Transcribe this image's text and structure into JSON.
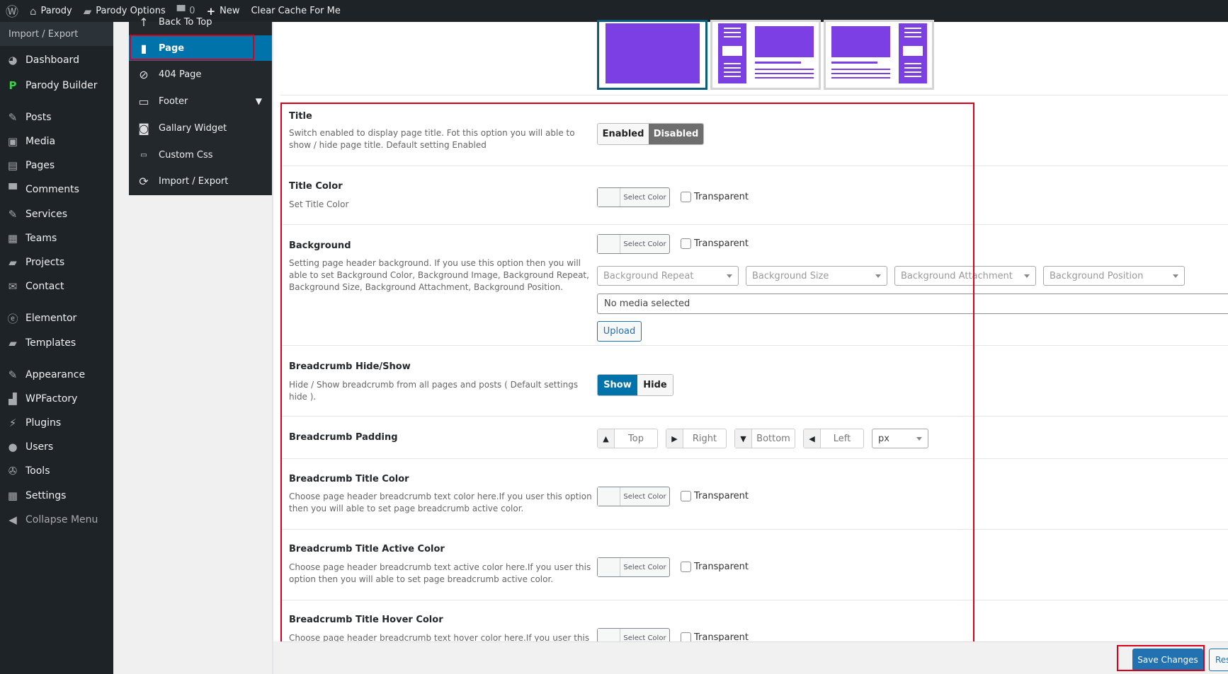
{
  "admin_bar": {
    "site_name": "Parody",
    "options_label": "Parody Options",
    "comments_count": "0",
    "new_label": "New",
    "clear_cache_label": "Clear Cache For Me"
  },
  "admin_menu": {
    "header": "Import / Export",
    "items": [
      {
        "label": "Dashboard",
        "icon": "dashboard-icon"
      },
      {
        "label": "Parody Builder",
        "icon": "parody-builder-icon"
      },
      {
        "label": "Posts",
        "icon": "pin-icon"
      },
      {
        "label": "Media",
        "icon": "media-icon"
      },
      {
        "label": "Pages",
        "icon": "pages-icon"
      },
      {
        "label": "Comments",
        "icon": "comment-icon"
      },
      {
        "label": "Services",
        "icon": "services-icon"
      },
      {
        "label": "Teams",
        "icon": "teams-icon"
      },
      {
        "label": "Projects",
        "icon": "folder-icon"
      },
      {
        "label": "Contact",
        "icon": "mail-icon"
      },
      {
        "label": "Elementor",
        "icon": "elementor-icon"
      },
      {
        "label": "Templates",
        "icon": "folder-icon"
      },
      {
        "label": "Appearance",
        "icon": "brush-icon"
      },
      {
        "label": "WPFactory",
        "icon": "chart-icon"
      },
      {
        "label": "Plugins",
        "icon": "plug-icon"
      },
      {
        "label": "Users",
        "icon": "user-icon"
      },
      {
        "label": "Tools",
        "icon": "wrench-icon"
      },
      {
        "label": "Settings",
        "icon": "settings-icon"
      },
      {
        "label": "Collapse Menu",
        "icon": "collapse-icon"
      }
    ]
  },
  "options_nav": {
    "items": [
      {
        "label": "Back To Top",
        "icon": "arrow-up-icon"
      },
      {
        "label": "Page",
        "icon": "page-icon",
        "active": true
      },
      {
        "label": "404 Page",
        "icon": "forbidden-icon"
      },
      {
        "label": "Footer",
        "icon": "monitor-icon",
        "has_submenu": true
      },
      {
        "label": "Gallary Widget",
        "icon": "camera-icon"
      },
      {
        "label": "Custom Css",
        "icon": "css-icon"
      },
      {
        "label": "Import / Export",
        "icon": "refresh-icon"
      }
    ]
  },
  "fields": {
    "title": {
      "label": "Title",
      "description": "Switch enabled to display page title. Fot this option you will able to show / hide page title. Default setting Enabled",
      "enabled_label": "Enabled",
      "disabled_label": "Disabled",
      "selected": "Disabled"
    },
    "title_color": {
      "label": "Title Color",
      "description": "Set Title Color",
      "picker_label": "Select Color",
      "transparent_label": "Transparent"
    },
    "background": {
      "label": "Background",
      "description": "Setting page header background. If you use this option then you will able to set Background Color, Background Image, Background Repeat, Background Size, Background Attachment, Background Position.",
      "picker_label": "Select Color",
      "transparent_label": "Transparent",
      "repeat_placeholder": "Background Repeat",
      "size_placeholder": "Background Size",
      "attachment_placeholder": "Background Attachment",
      "position_placeholder": "Background Position",
      "media_text": "No media selected",
      "upload_label": "Upload"
    },
    "breadcrumb_toggle": {
      "label": "Breadcrumb Hide/Show",
      "description": "Hide / Show breadcrumb from all pages and posts ( Default settings hide ).",
      "show_label": "Show",
      "hide_label": "Hide",
      "selected": "Show"
    },
    "breadcrumb_padding": {
      "label": "Breadcrumb Padding",
      "top": "Top",
      "right": "Right",
      "bottom": "Bottom",
      "left": "Left",
      "unit": "px"
    },
    "breadcrumb_title_color": {
      "label": "Breadcrumb Title Color",
      "description": "Choose page header breadcrumb text color here.If you user this option then you will able to set page breadcrumb active color.",
      "picker_label": "Select Color",
      "transparent_label": "Transparent"
    },
    "breadcrumb_active_color": {
      "label": "Breadcrumb Title Active Color",
      "description": "Choose page header breadcrumb text active color here.If you user this option then you will able to set page breadcrumb active color.",
      "picker_label": "Select Color",
      "transparent_label": "Transparent"
    },
    "breadcrumb_hover_color": {
      "label": "Breadcrumb Title Hover Color",
      "description": "Choose page header breadcrumb text hover color here.If you user this option then you will able to set page breadcrumb active color.",
      "picker_label": "Select Color",
      "transparent_label": "Transparent"
    }
  },
  "footer": {
    "save_label": "Save Changes",
    "reset_label": "Reset"
  },
  "colors": {
    "accent": "#0073aa",
    "layout_purple": "#7b3fe4",
    "highlight_red": "#d9001b",
    "admin_dark": "#1d2327"
  }
}
